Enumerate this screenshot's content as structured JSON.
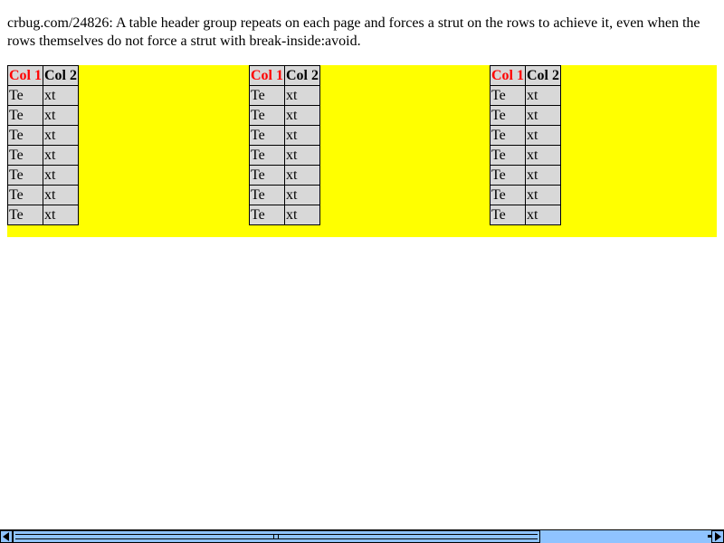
{
  "description": "crbug.com/24826: A table header group repeats on each page and forces a strut on the rows to achieve it, even when the rows themselves do not force a strut with break-inside:avoid.",
  "table": {
    "headers": [
      "Col 1",
      "Col 2"
    ],
    "rows": [
      [
        "Te",
        "xt"
      ],
      [
        "Te",
        "xt"
      ],
      [
        "Te",
        "xt"
      ],
      [
        "Te",
        "xt"
      ],
      [
        "Te",
        "xt"
      ],
      [
        "Te",
        "xt"
      ],
      [
        "Te",
        "xt"
      ]
    ]
  },
  "colors": {
    "band": "#ffff00",
    "cell_bg": "#d8d8d8",
    "header_col1": "#ff0000",
    "scrollbar": "#8fc3ff"
  },
  "icons": {
    "scroll_left": "triangle-left-icon",
    "scroll_right": "triangle-right-icon"
  }
}
